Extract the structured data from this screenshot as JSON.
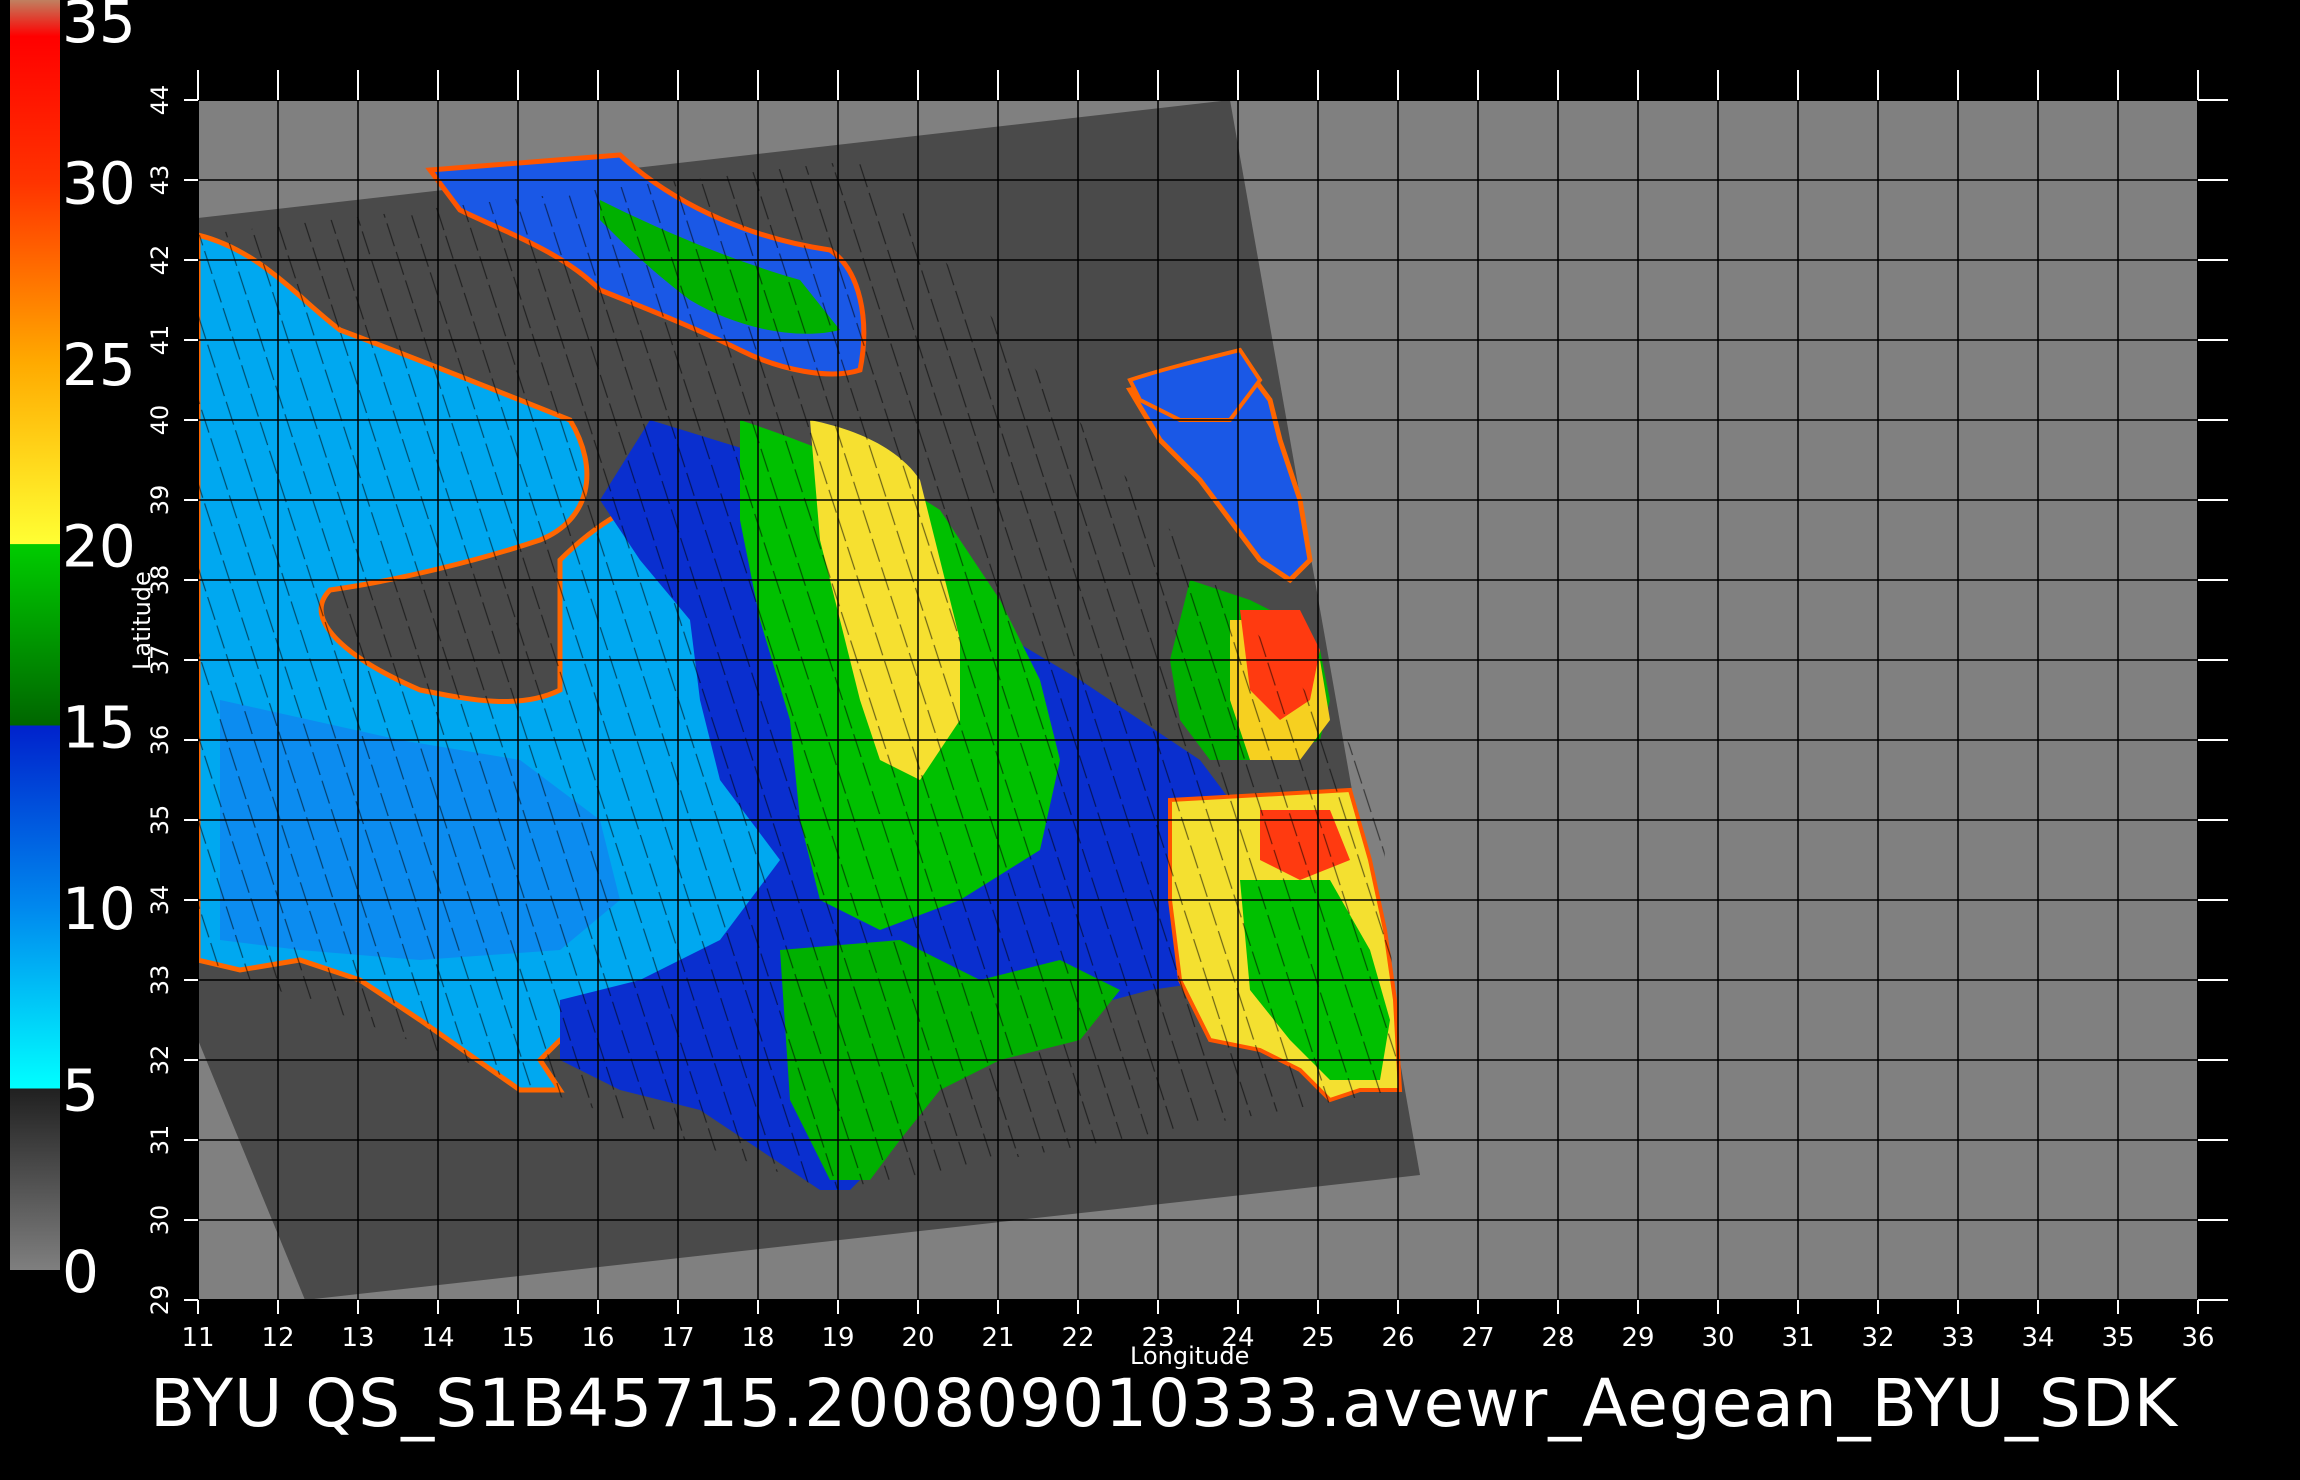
{
  "title": "BYU  QS_S1B45715.200809010333.avewr_Aegean_BYU_SDK",
  "colorbar": {
    "labels": [
      "35",
      "30",
      "25",
      "20",
      "15",
      "10",
      "5",
      "0"
    ],
    "stops": [
      {
        "value": 0,
        "color": "#7f7f7f"
      },
      {
        "value": 5,
        "color": "#202020"
      },
      {
        "value": 5.01,
        "color": "#00ffff"
      },
      {
        "value": 10,
        "color": "#0088ee"
      },
      {
        "value": 15,
        "color": "#0022cc"
      },
      {
        "value": 15.01,
        "color": "#006600"
      },
      {
        "value": 20,
        "color": "#00cc00"
      },
      {
        "value": 20.01,
        "color": "#ffff33"
      },
      {
        "value": 25,
        "color": "#ffaa00"
      },
      {
        "value": 30,
        "color": "#ff3300"
      },
      {
        "value": 34,
        "color": "#ff0000"
      },
      {
        "value": 35,
        "color": "#c08060"
      }
    ]
  },
  "colors": {
    "background": "#000000",
    "land": "#808080",
    "no_data_swath": "#4a4a4a",
    "grid": "#000000"
  },
  "map": {
    "xlabel": "Longitude",
    "ylabel": "Latitude",
    "lon_range": [
      11,
      36
    ],
    "lat_range": [
      29,
      44
    ],
    "lon_ticks": [
      "11",
      "12",
      "13",
      "14",
      "15",
      "16",
      "17",
      "18",
      "19",
      "20",
      "21",
      "22",
      "23",
      "24",
      "25",
      "26",
      "27",
      "28",
      "29",
      "30",
      "31",
      "32",
      "33",
      "34",
      "35",
      "36"
    ],
    "lat_ticks": [
      "29",
      "30",
      "31",
      "32",
      "33",
      "34",
      "35",
      "36",
      "37",
      "38",
      "39",
      "40",
      "41",
      "42",
      "43",
      "44"
    ]
  }
}
